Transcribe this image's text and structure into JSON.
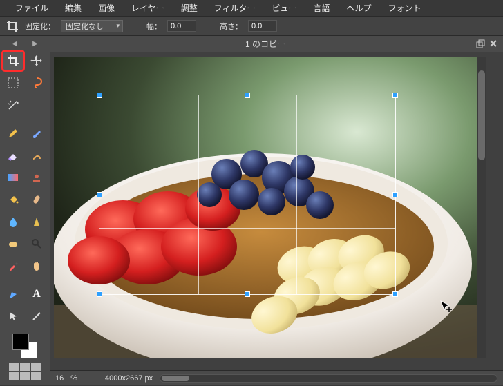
{
  "menu": {
    "items": [
      "ファイル",
      "編集",
      "画像",
      "レイヤー",
      "調整",
      "フィルター",
      "ビュー",
      "言語",
      "ヘルプ",
      "フォント"
    ]
  },
  "options": {
    "fix_label": "固定化：",
    "fix_mode": "固定化なし",
    "width_label": "幅：",
    "width_value": "0.0",
    "height_label": "高さ：",
    "height_value": "0.0"
  },
  "tab": {
    "title": "1 のコピー"
  },
  "status": {
    "zoom": "16",
    "zoom_unit": "%",
    "dimensions": "4000x2667 px"
  },
  "tools": {
    "crop": "crop",
    "move": "move",
    "marquee": "marquee",
    "lasso": "lasso",
    "wand": "wand",
    "pencil": "pencil",
    "brush": "brush",
    "eraser": "eraser",
    "smudge": "smudge",
    "gradient": "gradient",
    "stamp": "stamp",
    "bucket": "bucket",
    "heal": "heal",
    "blur": "blur",
    "sharpen": "sharpen",
    "sponge": "sponge",
    "dodge": "dodge",
    "eyedrop": "eyedrop",
    "hand": "hand",
    "pen": "pen",
    "type": "type",
    "pointer": "pointer",
    "line": "line"
  },
  "colors": {
    "fg": "#000000",
    "bg": "#ffffff"
  }
}
